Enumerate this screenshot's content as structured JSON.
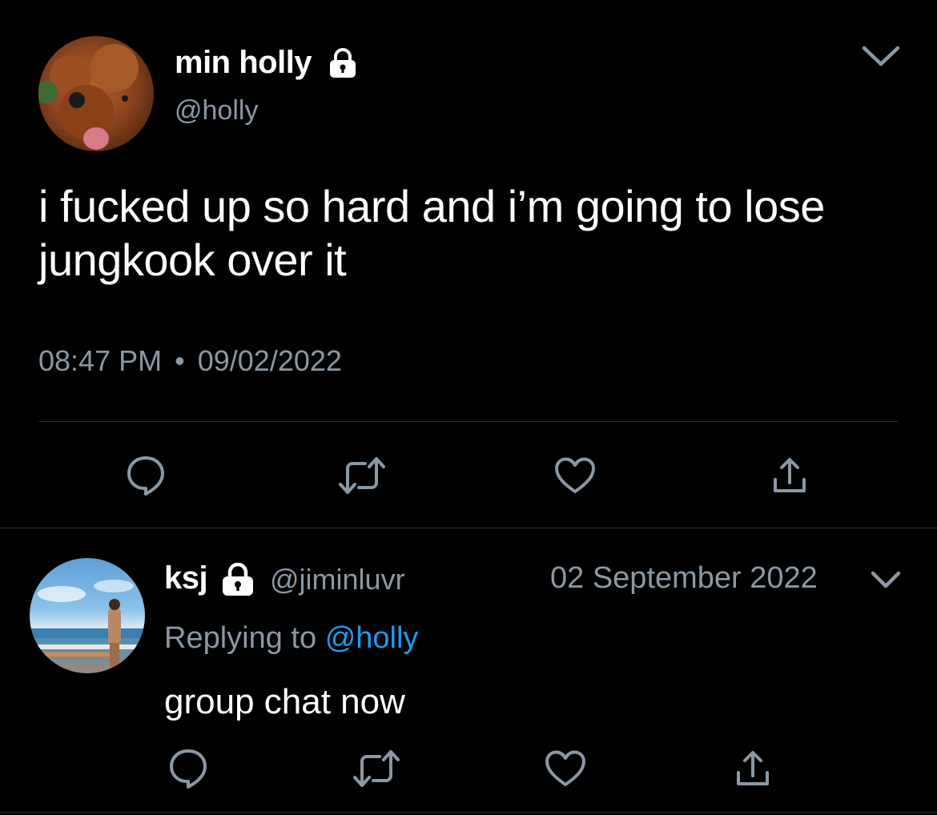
{
  "main_tweet": {
    "display_name": "min holly",
    "handle": "@holly",
    "text": "i fucked up so hard and i’m going to lose jungkook over it",
    "time": "08:47 PM",
    "separator": "•",
    "date": "09/02/2022",
    "protected": true,
    "icons": {
      "lock": "lock-icon",
      "more": "chevron-down-icon",
      "reply": "reply-icon",
      "retweet": "retweet-icon",
      "like": "heart-icon",
      "share": "share-icon"
    }
  },
  "reply_tweet": {
    "display_name": "ksj",
    "handle": "@jiminluvr",
    "date": "02 September 2022",
    "replying_label": "Replying to",
    "replying_handle": "@holly",
    "text": "group chat now",
    "protected": true
  },
  "colors": {
    "background": "#000000",
    "text": "#ffffff",
    "secondary": "#8b98a5",
    "link": "#1d9bf0",
    "divider": "#2f3336",
    "icon": "#8b98a5"
  }
}
